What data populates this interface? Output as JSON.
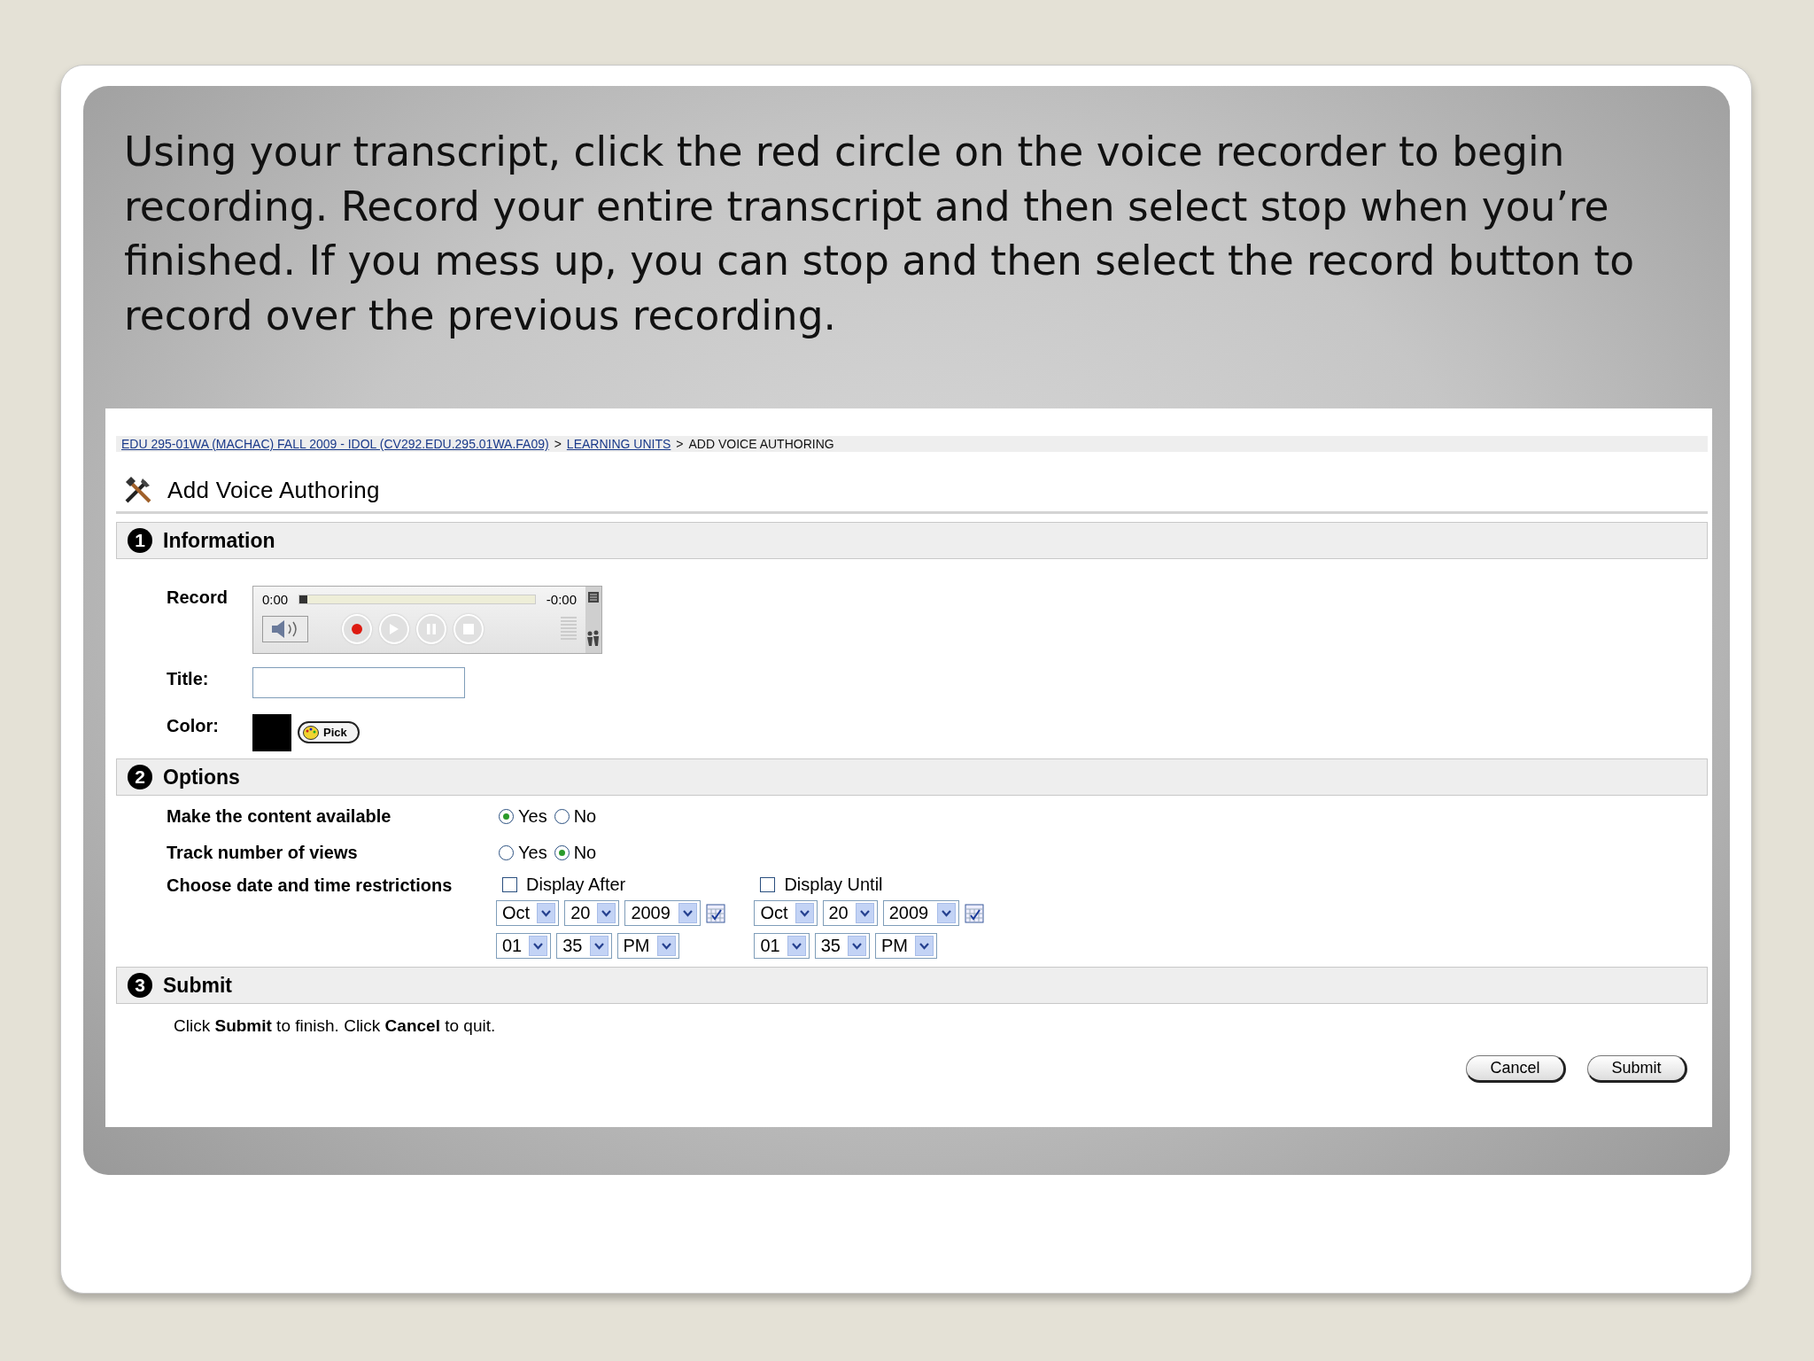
{
  "instruction": "Using your transcript, click the red circle on the voice recorder to begin recording.  Record your entire transcript and then select stop when you’re finished.  If you mess up, you can stop and then select the record button to record over the previous recording.",
  "breadcrumb": [
    {
      "kind": "link",
      "text": "EDU 295-01WA (MACHAC) FALL 2009 - IDOL (CV292.EDU.295.01WA.FA09)"
    },
    {
      "kind": "separator",
      "text": ">"
    },
    {
      "kind": "link",
      "text": "LEARNING UNITS"
    },
    {
      "kind": "separator",
      "text": ">"
    },
    {
      "kind": "current",
      "text": "ADD VOICE AUTHORING"
    }
  ],
  "page_title": "Add Voice Authoring",
  "information": {
    "number": "1",
    "title": "Information",
    "record": {
      "label": "Record",
      "elapsed": "0:00",
      "remaining": "-0:00",
      "level": 0
    },
    "title_field": {
      "label": "Title:"
    },
    "color_field": {
      "label": "Color:",
      "color": "#000000",
      "button": "Pick"
    }
  },
  "options": {
    "number": "2",
    "title": "Options",
    "rows": [
      {
        "kind": "radio",
        "label": "Make the content available",
        "choices": [
          {
            "text": "Yes",
            "selected": true
          },
          {
            "text": "No",
            "selected": false
          }
        ]
      },
      {
        "kind": "radio",
        "label": "Track number of views",
        "choices": [
          {
            "text": "Yes",
            "selected": false
          },
          {
            "text": "No",
            "selected": true
          }
        ]
      },
      {
        "kind": "dates",
        "label": "Choose date and time restrictions",
        "groups": [
          {
            "label": "Display After",
            "checked": false,
            "date": [
              "Oct",
              "20",
              "2009"
            ],
            "time": [
              "01",
              "35",
              "PM"
            ]
          },
          {
            "label": "Display Until",
            "checked": false,
            "date": [
              "Oct",
              "20",
              "2009"
            ],
            "time": [
              "01",
              "35",
              "PM"
            ]
          }
        ]
      }
    ]
  },
  "submit": {
    "number": "3",
    "title": "Submit",
    "text": "Click **Submit** to finish. Click **Cancel** to quit.",
    "buttons": [
      "Cancel",
      "Submit"
    ]
  }
}
